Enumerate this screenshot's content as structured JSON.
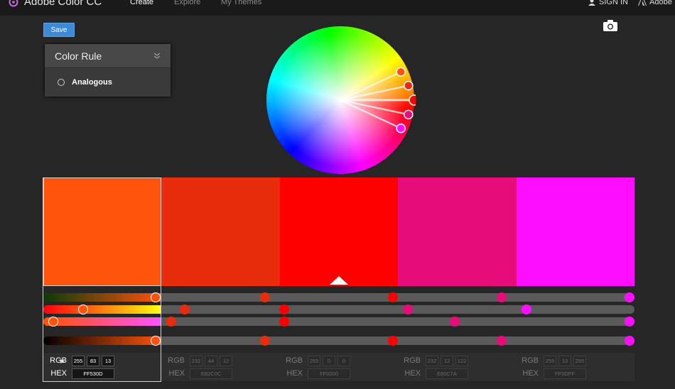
{
  "header": {
    "app_title": "Adobe Color CC",
    "nav": [
      "Create",
      "Explore",
      "My Themes"
    ],
    "sign_in": "SIGN IN",
    "adobe": "Adobe"
  },
  "toolbar": {
    "save_label": "Save"
  },
  "color_rule": {
    "title": "Color Rule",
    "selected": "Analogous"
  },
  "colors": {
    "accent": "#3c8ad8",
    "swatches": [
      "#FF530D",
      "#E82C0C",
      "#FF0000",
      "#E80C7A",
      "#FF0DFF"
    ]
  },
  "swatch_values": [
    {
      "rgb": [
        "255",
        "83",
        "13"
      ],
      "hex": "FF530D"
    },
    {
      "rgb": [
        "232",
        "44",
        "12"
      ],
      "hex": "E82C0C"
    },
    {
      "rgb": [
        "255",
        "0",
        "0"
      ],
      "hex": "FF0000"
    },
    {
      "rgb": [
        "232",
        "12",
        "122"
      ],
      "hex": "E80C7A"
    },
    {
      "rgb": [
        "255",
        "13",
        "255"
      ],
      "hex": "FF0DFF"
    }
  ],
  "labels": {
    "rgb": "RGB",
    "hex": "HEX"
  }
}
